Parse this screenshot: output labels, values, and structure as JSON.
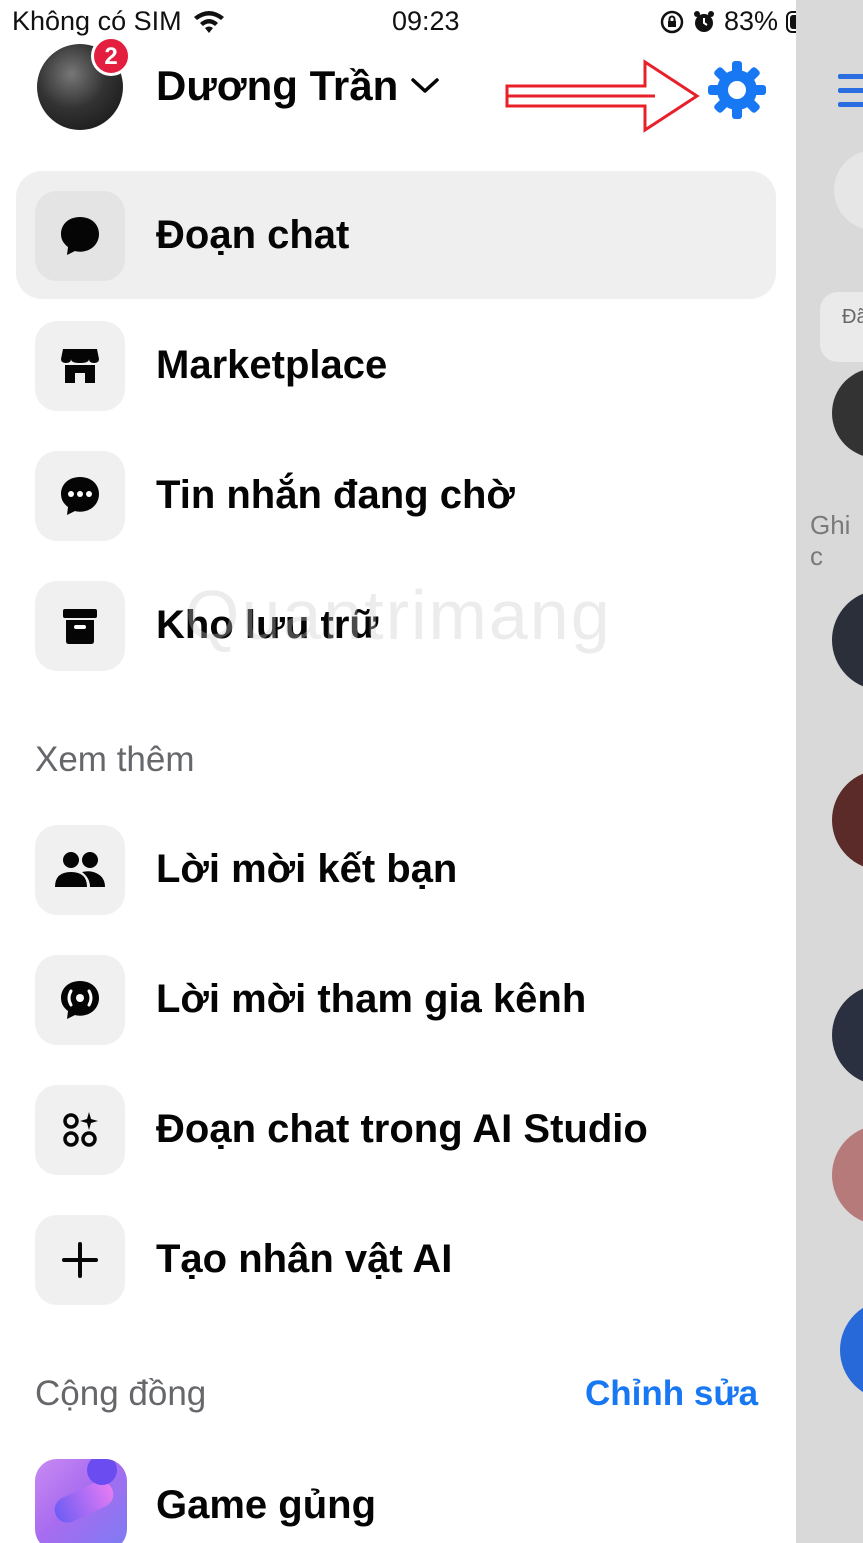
{
  "status_bar": {
    "carrier": "Không có SIM",
    "time": "09:23",
    "battery": "83%",
    "battery_level": 0.83
  },
  "header": {
    "user_name": "Dương Trần",
    "notification_count": "2"
  },
  "menu_items": [
    {
      "label": "Đoạn chat",
      "icon": "chat-bubble-icon",
      "active": true
    },
    {
      "label": "Marketplace",
      "icon": "store-icon",
      "active": false
    },
    {
      "label": "Tin nhắn đang chờ",
      "icon": "pending-message-icon",
      "active": false
    },
    {
      "label": "Kho lưu trữ",
      "icon": "archive-icon",
      "active": false
    }
  ],
  "more_section": {
    "title": "Xem thêm",
    "items": [
      {
        "label": "Lời mời kết bạn",
        "icon": "friends-icon"
      },
      {
        "label": "Lời mời tham gia kênh",
        "icon": "channel-icon"
      },
      {
        "label": "Đoạn chat trong AI Studio",
        "icon": "ai-studio-icon"
      },
      {
        "label": "Tạo nhân vật AI",
        "icon": "plus-icon"
      }
    ]
  },
  "community_section": {
    "title": "Cộng đồng",
    "edit_label": "Chỉnh sửa",
    "items": [
      {
        "label": "Game gủng",
        "icon": "game-community-icon"
      }
    ]
  },
  "background_panel": {
    "partial_pill_text": "Đã",
    "partial_text": "Ghi c"
  },
  "watermark": "Quantrimang",
  "colors": {
    "accent": "#1877f2",
    "badge": "#e41e3f",
    "annotation_arrow": "#e8202a",
    "active_item_bg": "#efefef"
  }
}
